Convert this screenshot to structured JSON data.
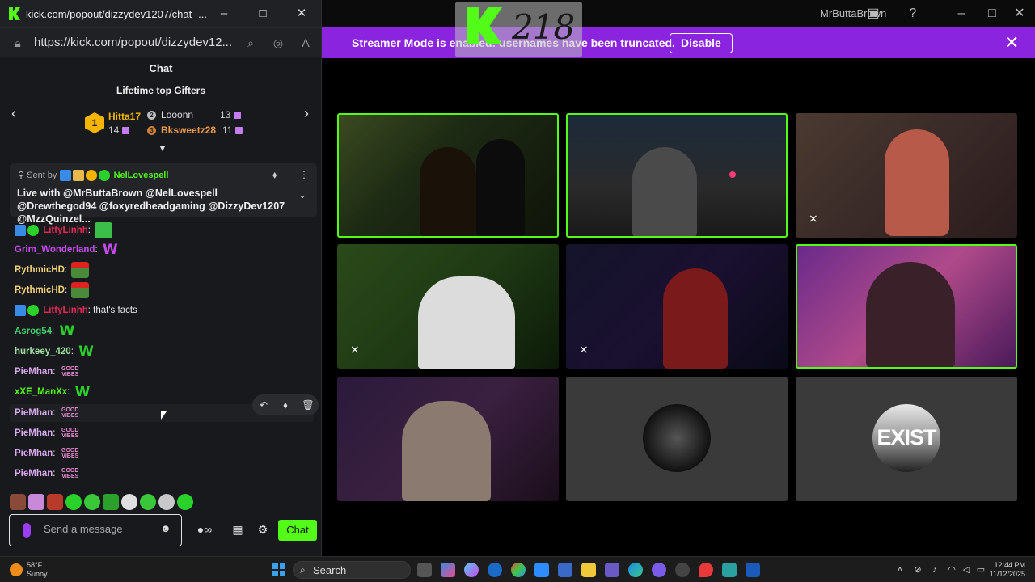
{
  "browser": {
    "title": "kick.com/popout/dizzydev1207/chat -...",
    "url": "https://kick.com/popout/dizzydev12..."
  },
  "chat": {
    "heading": "Chat",
    "gifters_title": "Lifetime top Gifters",
    "gifters": [
      {
        "rank": "1",
        "name": "Hitta17",
        "count": "14"
      },
      {
        "rank": "2",
        "name": "Looonn",
        "count": "13"
      },
      {
        "rank": "3",
        "name": "Bksweetz28",
        "count": "11"
      }
    ],
    "pinned": {
      "sent_by_label": "Sent by",
      "sender": "NelLovespell",
      "message": "Live with @MrButtaBrown @NelLovespell @Drewthegod94 @foxyredheadgaming @DizzyDev1207 @MzzQuinzel..."
    },
    "messages": [
      {
        "user": "LittyLinhh",
        "color": "#e8295b",
        "text": "",
        "emote": "pepe"
      },
      {
        "user": "Grim_Wonderland",
        "color": "#c54cf2",
        "text": "",
        "emote": "W-purple"
      },
      {
        "user": "RythmicHD",
        "color": "#f3d37a",
        "text": "",
        "emote": "pepe-santa"
      },
      {
        "user": "RythmicHD",
        "color": "#f3d37a",
        "text": "",
        "emote": "pepe-santa"
      },
      {
        "user": "LittyLinhh",
        "color": "#e8295b",
        "text": "that's facts",
        "emote": ""
      },
      {
        "user": "Asrog54",
        "color": "#40d070",
        "text": "",
        "emote": "W"
      },
      {
        "user": "hurkeey_420",
        "color": "#9fe29f",
        "text": "",
        "emote": "W"
      },
      {
        "user": "PieMhan",
        "color": "#d8a8f0",
        "text": "",
        "emote": "goodvibes"
      },
      {
        "user": "xXE_ManXx",
        "color": "#53fc18",
        "text": "",
        "emote": "W"
      },
      {
        "user": "PieMhan",
        "color": "#d8a8f0",
        "text": "",
        "emote": "goodvibes"
      },
      {
        "user": "PieMhan",
        "color": "#d8a8f0",
        "text": "",
        "emote": "goodvibes"
      },
      {
        "user": "PieMhan",
        "color": "#d8a8f0",
        "text": "",
        "emote": "goodvibes"
      },
      {
        "user": "PieMhan",
        "color": "#d8a8f0",
        "text": "",
        "emote": "goodvibes"
      }
    ],
    "emote_good": "GOOD",
    "emote_vibes": "VIBES",
    "emote_w": "W",
    "input_placeholder": "Send a message",
    "send_label": "Chat"
  },
  "app": {
    "title": "MrButtaBrown",
    "logo_number": "218",
    "banner_text": "Streamer Mode is enabled: usernames have been truncated.",
    "banner_button": "Disable",
    "avatar_text": "EXIST"
  },
  "taskbar": {
    "temperature": "58°F",
    "condition": "Sunny",
    "search_label": "Search",
    "time": "12:44 PM",
    "date": "11/12/2025"
  },
  "colors": {
    "kick_green": "#53fc18",
    "banner_purple": "#8b24df"
  }
}
